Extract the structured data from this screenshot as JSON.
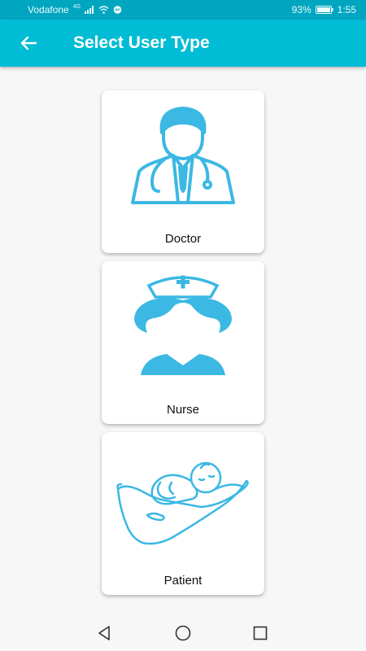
{
  "status_bar": {
    "carrier": "Vodafone",
    "network": "4G",
    "battery": "93%",
    "time": "1:55",
    "icons": [
      "signal-icon",
      "wifi-icon",
      "messenger-icon",
      "battery-icon"
    ]
  },
  "app_bar": {
    "title": "Select User Type",
    "back_icon": "arrow-left-icon",
    "color": "#00bcd4"
  },
  "user_types": [
    {
      "label": "Doctor",
      "icon": "doctor-icon"
    },
    {
      "label": "Nurse",
      "icon": "nurse-icon"
    },
    {
      "label": "Patient",
      "icon": "patient-baby-hand-icon"
    }
  ],
  "accent_color": "#3bb8e3",
  "nav_bar": {
    "icons": [
      "back-triangle-icon",
      "home-circle-icon",
      "recents-square-icon"
    ]
  }
}
